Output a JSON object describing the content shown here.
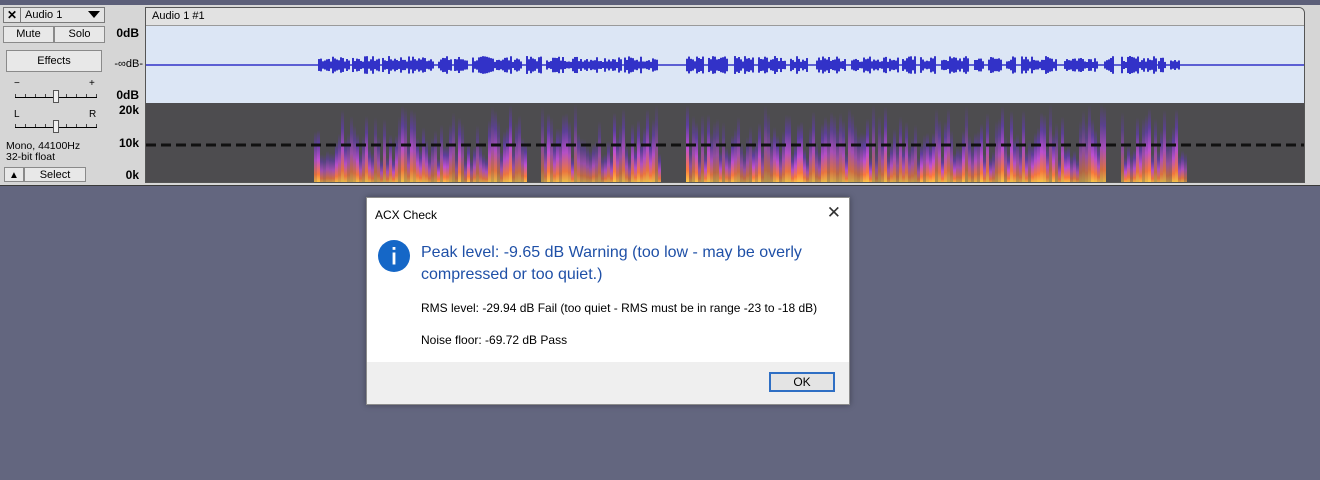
{
  "track_control": {
    "close_symbol": "✕",
    "track_name": "Audio 1",
    "mute_label": "Mute",
    "solo_label": "Solo",
    "effects_label": "Effects",
    "gain_minus": "−",
    "gain_plus": "+",
    "pan_left": "L",
    "pan_right": "R",
    "format_line1": "Mono, 44100Hz",
    "format_line2": "32-bit float",
    "collapse_symbol": "▲",
    "select_label": "Select"
  },
  "ruler": {
    "wave_labels": [
      "0dB",
      "-∞dB-",
      "0dB"
    ],
    "spectro_labels": [
      "20k",
      "10k",
      "0k"
    ]
  },
  "clip": {
    "name": "Audio 1 #1"
  },
  "dialog": {
    "title": "ACX Check",
    "close_symbol": "✕",
    "peak_text": "Peak level:  -9.65 dB  Warning (too low - may be overly compressed or too quiet.)",
    "rms_text": "RMS level:  -29.94 dB  Fail (too quiet - RMS must be in range -23 to -18 dB)",
    "noise_text": "Noise floor:  -69.72 dB  Pass",
    "ok_label": "OK"
  },
  "colors": {
    "waveform": "#3232c8",
    "spectrogram_bg": "#4d4c4f",
    "info_icon": "#1567c7",
    "dialog_text_accent": "#1f50a7"
  }
}
